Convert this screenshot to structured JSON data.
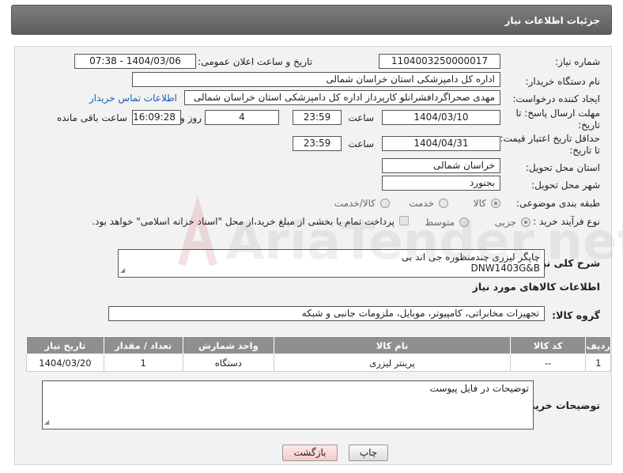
{
  "header": {
    "title": "جزئیات اطلاعات نیاز"
  },
  "form": {
    "need_number_label": "شماره نیاز:",
    "need_number": "1104003250000017",
    "announce_label": "تاریخ و ساعت اعلان عمومی:",
    "announce_value": "1404/03/06 - 07:38",
    "buyer_org_label": "نام دستگاه خریدار:",
    "buyer_org": "اداره کل دامپزشکی استان خراسان شمالی",
    "creator_label": "ایجاد کننده درخواست:",
    "creator": "مهدی صحراگردافشرانلو کارپرداز اداره کل دامپزشکی استان خراسان شمالی",
    "contact_link": "اطلاعات تماس خریدار",
    "deadline_label_1": "مهلت ارسال پاسخ: تا",
    "deadline_label_2": "تاریخ:",
    "deadline_date": "1404/03/10",
    "time_word": "ساعت",
    "deadline_time": "23:59",
    "days_value": "4",
    "days_word": "روز و",
    "remaining_time": "16:09:28",
    "remaining_word": "ساعت باقی مانده",
    "price_label_1": "حداقل تاریخ اعتبار قیمت:",
    "price_label_2": "تا تاریخ:",
    "price_date": "1404/04/31",
    "price_time": "23:59",
    "province_label": "استان محل تحویل:",
    "province": "خراسان شمالی",
    "city_label": "شهر محل تحویل:",
    "city": "بجنورد",
    "category_label": "طبقه بندی موضوعی:",
    "category_options": [
      "کالا",
      "خدمت",
      "کالا/خدمت"
    ],
    "process_label": "نوع فرآیند خرید :",
    "process_options": [
      "جزیی",
      "متوسط"
    ],
    "payment_note": "پرداخت تمام یا بخشی از مبلغ خرید،از محل \"اسناد خزانه اسلامی\" خواهد بود.",
    "summary_label": "شرح کلی نیاز:",
    "summary_line1": "چاپگر لیزری چندمنظوره جی اند بی",
    "summary_line2": "DNW1403G&B",
    "goods_section_title": "اطلاعات کالاهای مورد نیاز",
    "goods_group_label": "گروه کالا:",
    "goods_group": "تجهیزات مخابراتی، کامپیوتر، موبایل، ملزومات جانبی و شبکه"
  },
  "table": {
    "headers": [
      "ردیف",
      "کد کالا",
      "نام کالا",
      "واحد شمارش",
      "تعداد / مقدار",
      "تاریخ نیاز"
    ],
    "rows": [
      [
        "1",
        "--",
        "پرینتر لیزری",
        "دستگاه",
        "1",
        "1404/03/20"
      ]
    ]
  },
  "notes": {
    "label": "توضیحات خریدار:",
    "value": "توضیحات در فایل پیوست"
  },
  "buttons": {
    "print": "چاپ",
    "back": "بازگشت"
  },
  "watermark": {
    "text": "AriaTender.net"
  }
}
